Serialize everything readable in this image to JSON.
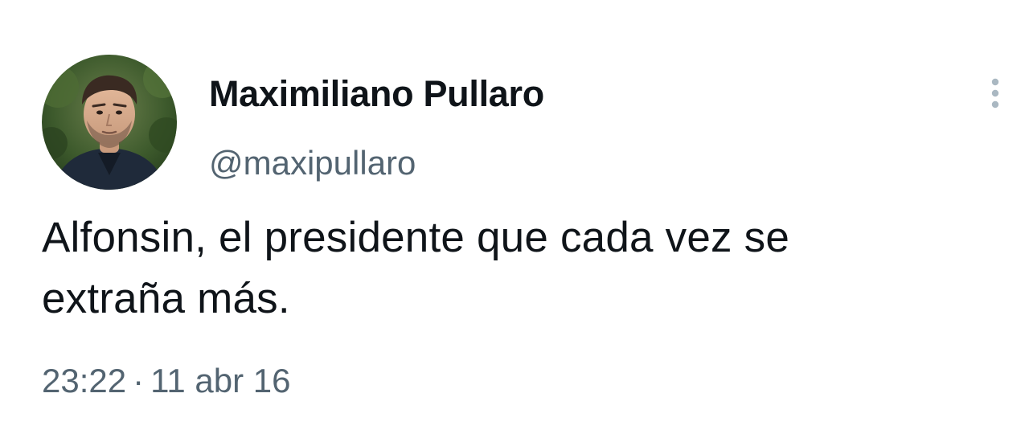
{
  "tweet": {
    "author": {
      "display_name": "Maximiliano Pullaro",
      "handle": "@maxipullaro",
      "avatar_icon": "profile-photo"
    },
    "more_icon": "more-options-icon",
    "text_lines": [
      "Alfonsin, el presidente que cada vez se",
      "extraña más."
    ],
    "time": "23:22",
    "separator": "·",
    "date": "11 abr 16"
  },
  "colors": {
    "text": "#0f1419",
    "secondary_text": "#536471",
    "background": "#ffffff",
    "more_icon": "#aab8c2"
  }
}
